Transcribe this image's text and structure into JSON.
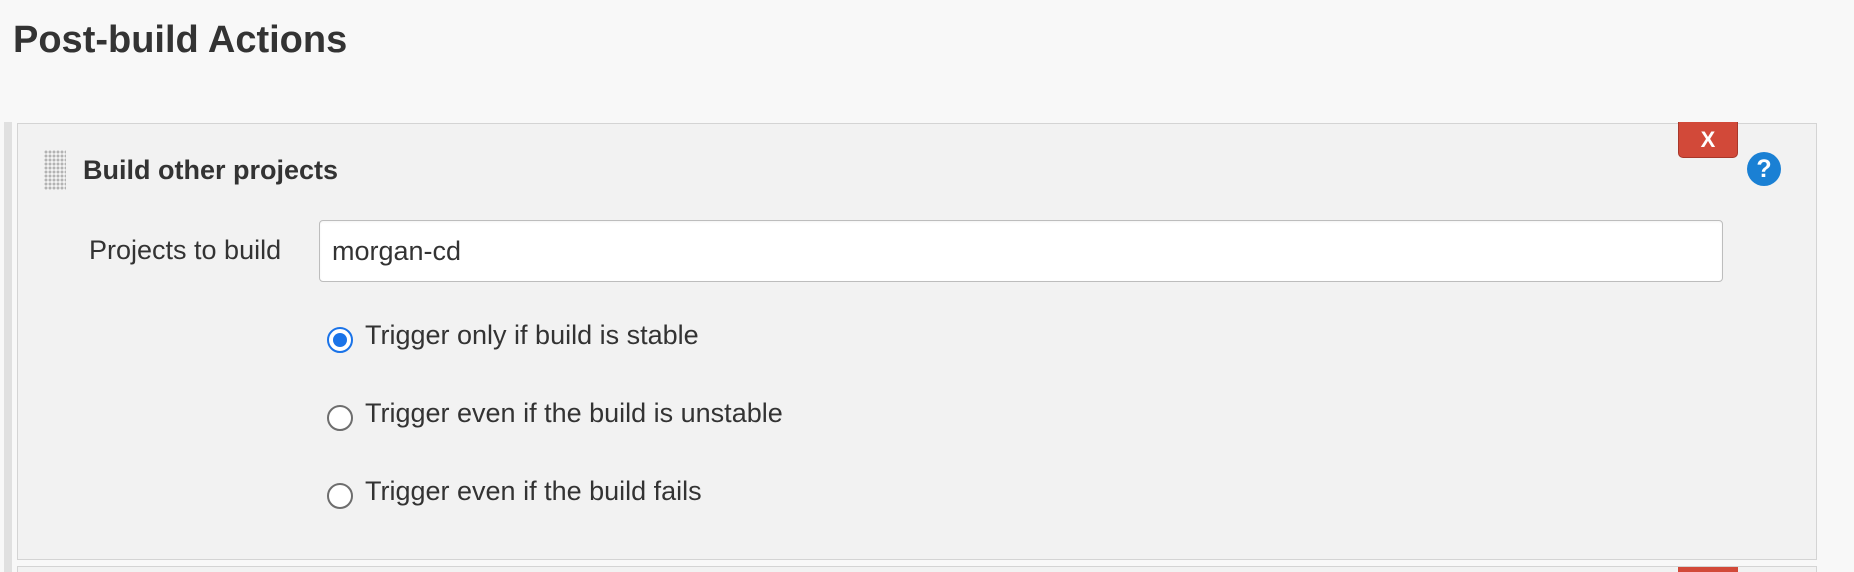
{
  "page": {
    "title": "Post-build Actions"
  },
  "section": {
    "title": "Build other projects",
    "delete_label": "X",
    "help_label": "?",
    "field_label": "Projects to build",
    "field_value": "morgan-cd",
    "options": [
      {
        "label": "Trigger only if build is stable",
        "checked": true
      },
      {
        "label": "Trigger even if the build is unstable",
        "checked": false
      },
      {
        "label": "Trigger even if the build fails",
        "checked": false
      }
    ]
  },
  "colors": {
    "accent": "#1a73e8",
    "delete": "#d24939",
    "help": "#1a80d4"
  }
}
